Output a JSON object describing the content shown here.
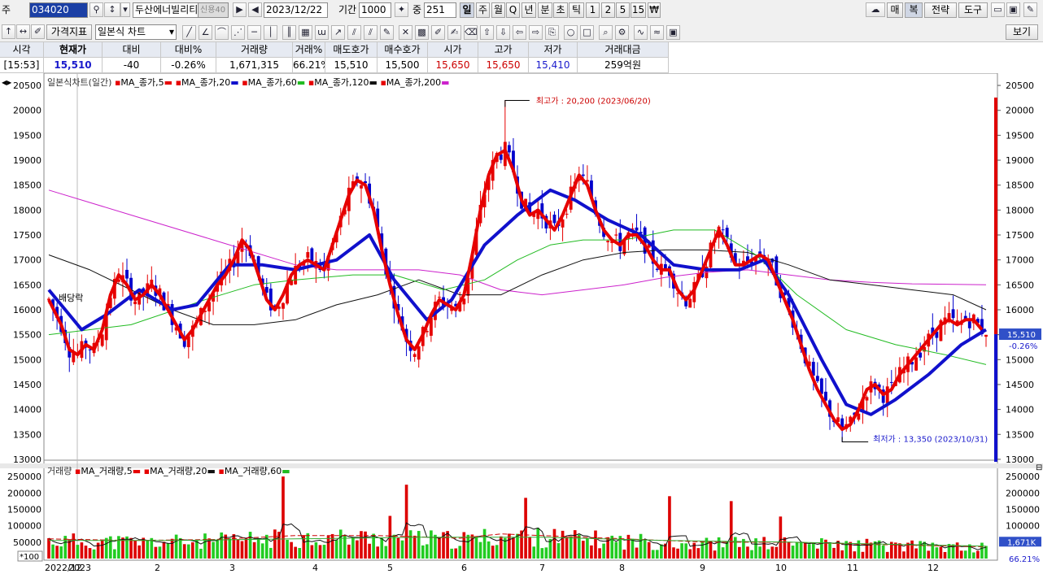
{
  "toolbar": {
    "market_label": "주",
    "code": "034020",
    "name": "두산에너빌리티",
    "name_badge": "신용40",
    "date": "2023/12/22",
    "period_label": "기간",
    "period_value": "1000",
    "zoom_label": "중",
    "zoom_value": "251",
    "interval_buttons": [
      "일",
      "주",
      "월",
      "Q",
      "년",
      "분",
      "초",
      "틱",
      "1",
      "2",
      "5",
      "15",
      "₩"
    ],
    "right_buttons": {
      "mae": "매",
      "bok": "복",
      "strategy": "전략",
      "tools": "도구"
    },
    "indicator_button": "가격지표",
    "chart_type": "일본식 차트",
    "view_button": "보기"
  },
  "quote": {
    "headers": [
      "시각",
      "현재가",
      "대비",
      "대비%",
      "거래량",
      "거래%",
      "매도호가",
      "매수호가",
      "시가",
      "고가",
      "저가",
      "거래대금"
    ],
    "values": [
      "[15:53]",
      "15,510",
      "-40",
      "-0.26%",
      "1,671,315",
      "66.21%",
      "15,510",
      "15,500",
      "15,650",
      "15,650",
      "15,410",
      "259억원"
    ]
  },
  "price_legend": {
    "title": "일본식차트(일간)",
    "items": [
      "MA_종가,5",
      "MA_종가,20",
      "MA_종가,60",
      "MA_종가,120",
      "MA_종가,200"
    ]
  },
  "volume_legend": {
    "title": "거래량",
    "items": [
      "MA_거래량,5",
      "MA_거래량,20",
      "MA_거래량,60"
    ]
  },
  "annotations": {
    "high": "최고가 : 20,200 (2023/06/20)",
    "low": "최저가 : 13,350 (2023/10/31)",
    "dividend": "배당락"
  },
  "axis_badges": {
    "price": "15,510",
    "change": "-0.26%",
    "volume": "1,671K",
    "volume_pct": "66.21%",
    "volume_unit": "*100"
  },
  "colors": {
    "up": "#e60000",
    "down": "#0000cc",
    "ma5": "#e60000",
    "ma20": "#1010cc",
    "ma60": "#22bb22",
    "ma120": "#111111",
    "ma200": "#cc22cc",
    "vol_up": "#dd0000",
    "vol_down": "#22cc22"
  },
  "chart_data": [
    {
      "type": "candlestick",
      "title": "일본식차트(일간)",
      "x_ticks": [
        "2022/12",
        "2023",
        "2",
        "3",
        "4",
        "5",
        "6",
        "7",
        "8",
        "9",
        "10",
        "11",
        "12"
      ],
      "ylim": [
        12950,
        20550
      ],
      "y_ticks": [
        13000,
        13500,
        14000,
        14500,
        15000,
        15500,
        16000,
        16500,
        17000,
        17500,
        18000,
        18500,
        19000,
        19500,
        20000,
        20500
      ],
      "last_price": 15510,
      "high": {
        "value": 20200,
        "date": "2023/06/20"
      },
      "low": {
        "value": 13350,
        "date": "2023/10/31"
      },
      "ma5": [
        [
          0,
          16200
        ],
        [
          3,
          15700
        ],
        [
          5,
          15200
        ],
        [
          7,
          15100
        ],
        [
          9,
          15300
        ],
        [
          11,
          15200
        ],
        [
          13,
          15600
        ],
        [
          15,
          16300
        ],
        [
          17,
          16700
        ],
        [
          19,
          16500
        ],
        [
          21,
          16200
        ],
        [
          23,
          16300
        ],
        [
          25,
          16500
        ],
        [
          27,
          16300
        ],
        [
          29,
          16000
        ],
        [
          31,
          15700
        ],
        [
          33,
          15400
        ],
        [
          35,
          15600
        ],
        [
          37,
          15900
        ],
        [
          39,
          16200
        ],
        [
          41,
          16500
        ],
        [
          43,
          16700
        ],
        [
          45,
          17000
        ],
        [
          47,
          17400
        ],
        [
          49,
          17200
        ],
        [
          51,
          16700
        ],
        [
          53,
          16200
        ],
        [
          55,
          16000
        ],
        [
          57,
          16300
        ],
        [
          59,
          16700
        ],
        [
          61,
          16900
        ],
        [
          63,
          17000
        ],
        [
          65,
          16900
        ],
        [
          67,
          16800
        ],
        [
          69,
          17300
        ],
        [
          71,
          17800
        ],
        [
          73,
          18300
        ],
        [
          75,
          18600
        ],
        [
          77,
          18500
        ],
        [
          79,
          18000
        ],
        [
          81,
          17200
        ],
        [
          83,
          16500
        ],
        [
          85,
          15900
        ],
        [
          87,
          15400
        ],
        [
          89,
          15200
        ],
        [
          91,
          15500
        ],
        [
          93,
          15900
        ],
        [
          95,
          16200
        ],
        [
          97,
          16100
        ],
        [
          99,
          16000
        ],
        [
          101,
          16300
        ],
        [
          103,
          17100
        ],
        [
          105,
          18000
        ],
        [
          107,
          18700
        ],
        [
          109,
          19100
        ],
        [
          111,
          19200
        ],
        [
          113,
          18800
        ],
        [
          115,
          18200
        ],
        [
          117,
          17900
        ],
        [
          119,
          18000
        ],
        [
          121,
          17800
        ],
        [
          123,
          17600
        ],
        [
          125,
          17900
        ],
        [
          127,
          18300
        ],
        [
          129,
          18700
        ],
        [
          131,
          18500
        ],
        [
          133,
          18000
        ],
        [
          135,
          17600
        ],
        [
          137,
          17400
        ],
        [
          139,
          17300
        ],
        [
          141,
          17500
        ],
        [
          143,
          17500
        ],
        [
          145,
          17300
        ],
        [
          147,
          17000
        ],
        [
          149,
          16800
        ],
        [
          151,
          16800
        ],
        [
          153,
          16400
        ],
        [
          155,
          16200
        ],
        [
          157,
          16400
        ],
        [
          159,
          16800
        ],
        [
          161,
          17200
        ],
        [
          163,
          17600
        ],
        [
          165,
          17300
        ],
        [
          167,
          16900
        ],
        [
          169,
          16900
        ],
        [
          171,
          17000
        ],
        [
          173,
          17100
        ],
        [
          175,
          17000
        ],
        [
          177,
          16600
        ],
        [
          179,
          16200
        ],
        [
          181,
          15800
        ],
        [
          183,
          15300
        ],
        [
          185,
          14800
        ],
        [
          187,
          14400
        ],
        [
          189,
          14100
        ],
        [
          191,
          13800
        ],
        [
          193,
          13600
        ],
        [
          195,
          13700
        ],
        [
          197,
          14000
        ],
        [
          199,
          14400
        ],
        [
          201,
          14500
        ],
        [
          203,
          14300
        ],
        [
          205,
          14400
        ],
        [
          207,
          14700
        ],
        [
          209,
          14900
        ],
        [
          211,
          15100
        ],
        [
          213,
          15300
        ],
        [
          215,
          15500
        ],
        [
          217,
          15700
        ],
        [
          219,
          15800
        ],
        [
          221,
          15700
        ],
        [
          223,
          15800
        ],
        [
          225,
          15800
        ],
        [
          227,
          15600
        ]
      ],
      "ma20": [
        [
          0,
          16400
        ],
        [
          8,
          15600
        ],
        [
          14,
          15900
        ],
        [
          22,
          16400
        ],
        [
          30,
          16000
        ],
        [
          36,
          16100
        ],
        [
          44,
          16900
        ],
        [
          52,
          16900
        ],
        [
          60,
          16800
        ],
        [
          70,
          17000
        ],
        [
          78,
          17500
        ],
        [
          84,
          16600
        ],
        [
          92,
          15800
        ],
        [
          98,
          16200
        ],
        [
          106,
          17300
        ],
        [
          114,
          17900
        ],
        [
          122,
          18400
        ],
        [
          128,
          18200
        ],
        [
          136,
          17800
        ],
        [
          144,
          17500
        ],
        [
          152,
          16900
        ],
        [
          160,
          16800
        ],
        [
          168,
          16800
        ],
        [
          174,
          17000
        ],
        [
          180,
          16300
        ],
        [
          188,
          15000
        ],
        [
          194,
          14100
        ],
        [
          200,
          13900
        ],
        [
          206,
          14200
        ],
        [
          214,
          14700
        ],
        [
          222,
          15300
        ],
        [
          228,
          15600
        ]
      ],
      "ma60": [
        [
          0,
          15500
        ],
        [
          20,
          15700
        ],
        [
          38,
          16200
        ],
        [
          50,
          16500
        ],
        [
          60,
          16600
        ],
        [
          74,
          16700
        ],
        [
          84,
          16700
        ],
        [
          96,
          16400
        ],
        [
          106,
          16600
        ],
        [
          114,
          17000
        ],
        [
          122,
          17300
        ],
        [
          130,
          17400
        ],
        [
          140,
          17400
        ],
        [
          152,
          17600
        ],
        [
          162,
          17600
        ],
        [
          172,
          17100
        ],
        [
          182,
          16300
        ],
        [
          194,
          15600
        ],
        [
          206,
          15300
        ],
        [
          218,
          15100
        ],
        [
          228,
          14900
        ]
      ],
      "ma120": [
        [
          0,
          17100
        ],
        [
          10,
          16800
        ],
        [
          20,
          16400
        ],
        [
          30,
          16000
        ],
        [
          40,
          15700
        ],
        [
          50,
          15700
        ],
        [
          60,
          15800
        ],
        [
          70,
          16100
        ],
        [
          80,
          16300
        ],
        [
          90,
          16600
        ],
        [
          100,
          16300
        ],
        [
          110,
          16300
        ],
        [
          120,
          16700
        ],
        [
          130,
          17000
        ],
        [
          140,
          17150
        ],
        [
          150,
          17200
        ],
        [
          160,
          17200
        ],
        [
          170,
          17150
        ],
        [
          180,
          16900
        ],
        [
          190,
          16600
        ],
        [
          200,
          16500
        ],
        [
          210,
          16400
        ],
        [
          220,
          16300
        ],
        [
          228,
          16000
        ]
      ],
      "ma200": [
        [
          0,
          18400
        ],
        [
          20,
          17900
        ],
        [
          40,
          17400
        ],
        [
          60,
          16900
        ],
        [
          70,
          16800
        ],
        [
          80,
          16800
        ],
        [
          90,
          16800
        ],
        [
          100,
          16700
        ],
        [
          110,
          16400
        ],
        [
          120,
          16300
        ],
        [
          130,
          16400
        ],
        [
          140,
          16500
        ],
        [
          150,
          16650
        ],
        [
          160,
          16750
        ],
        [
          170,
          16800
        ],
        [
          180,
          16700
        ],
        [
          190,
          16600
        ],
        [
          200,
          16550
        ],
        [
          210,
          16520
        ],
        [
          228,
          16500
        ]
      ]
    },
    {
      "type": "bar",
      "title": "거래량",
      "unit": "*100",
      "ylim": [
        0,
        270000
      ],
      "y_ticks": [
        50000,
        100000,
        150000,
        200000,
        250000
      ],
      "last_volume": 16713,
      "last_volume_pct": "66.21%",
      "spikes": [
        [
          57,
          250000
        ],
        [
          83,
          130000
        ],
        [
          87,
          225000
        ],
        [
          116,
          185000
        ],
        [
          123,
          90000
        ],
        [
          151,
          190000
        ],
        [
          166,
          175000
        ],
        [
          178,
          128000
        ],
        [
          199,
          60000
        ],
        [
          210,
          55000
        ]
      ],
      "ma20": [
        [
          0,
          60000
        ],
        [
          20,
          55000
        ],
        [
          40,
          58000
        ],
        [
          60,
          70000
        ],
        [
          80,
          70000
        ],
        [
          100,
          62000
        ],
        [
          110,
          75000
        ],
        [
          120,
          70000
        ],
        [
          140,
          60000
        ],
        [
          160,
          50000
        ],
        [
          180,
          50000
        ],
        [
          200,
          43000
        ],
        [
          220,
          38000
        ],
        [
          228,
          36000
        ]
      ],
      "ma60": [
        [
          0,
          55000
        ],
        [
          30,
          55000
        ],
        [
          60,
          60000
        ],
        [
          90,
          65000
        ],
        [
          120,
          65000
        ],
        [
          150,
          55000
        ],
        [
          180,
          50000
        ],
        [
          210,
          42000
        ],
        [
          228,
          38000
        ]
      ]
    }
  ]
}
